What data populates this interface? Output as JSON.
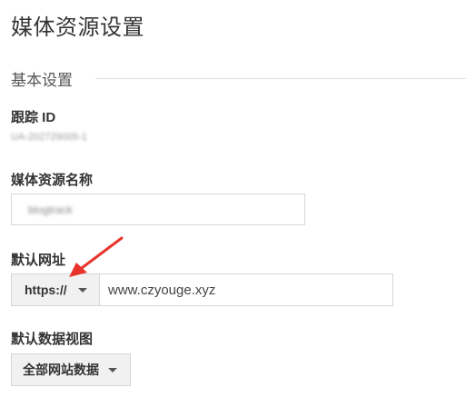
{
  "page": {
    "title": "媒体资源设置"
  },
  "section": {
    "title": "基本设置"
  },
  "tracking": {
    "label": "跟踪 ID",
    "value": "UA-202729005-1"
  },
  "property_name": {
    "label": "媒体资源名称",
    "value": "blogtrack"
  },
  "default_url": {
    "label": "默认网址",
    "protocol": "https://",
    "value": "www.czyouge.xyz"
  },
  "default_view": {
    "label": "默认数据视图",
    "value": "全部网站数据"
  },
  "colors": {
    "annotation_arrow": "#e8332a",
    "border": "#d6d6d6",
    "select_bg": "#f1f1f1"
  }
}
